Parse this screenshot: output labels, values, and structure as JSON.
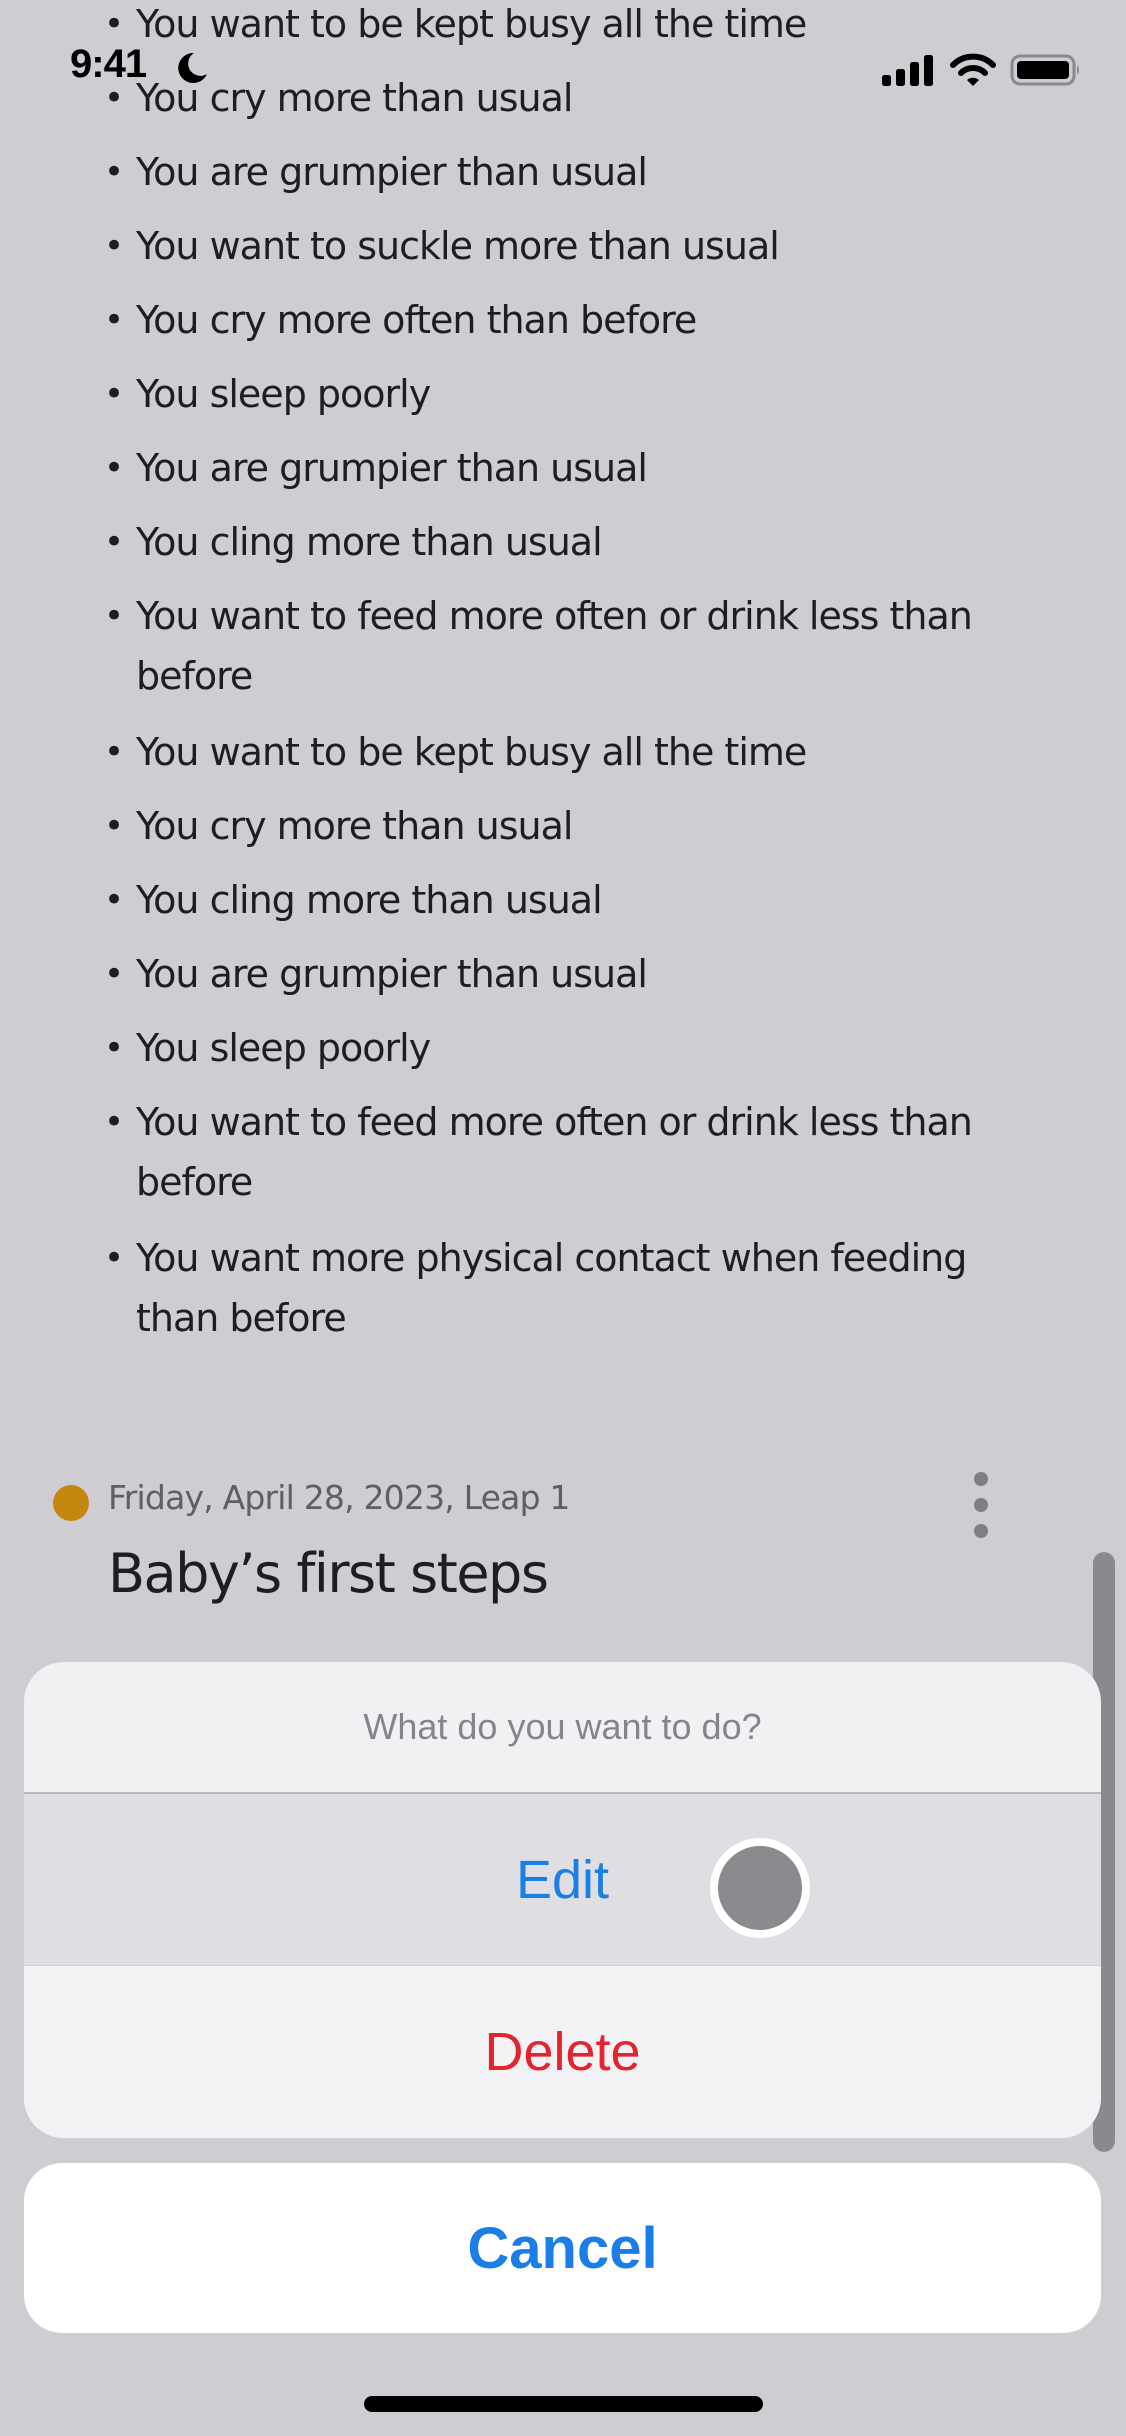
{
  "status_bar": {
    "time": "9:41",
    "focus_icon": "moon-icon",
    "signal_icon": "cellular-signal-icon",
    "wifi_icon": "wifi-icon",
    "battery_icon": "battery-icon"
  },
  "symptom_list": [
    "You want to be kept busy all the time",
    "You cry more than usual",
    "You are grumpier than usual",
    "You want to suckle more than usual",
    "You cry more often than before",
    "You sleep poorly",
    "You are grumpier than usual",
    "You cling more than usual",
    "You want to feed more often or drink less than before",
    "You want to be kept busy all the time",
    "You cry more than usual",
    "You cling more than usual",
    "You are grumpier than usual",
    "You sleep poorly",
    "You want to feed more often or drink less than before",
    "You want more physical contact when feeding than before"
  ],
  "bullet_char": "•",
  "entry": {
    "meta": "Friday, April 28, 2023, Leap 1",
    "title": "Baby’s first steps",
    "dot_color": "#c5870f",
    "more_icon": "more-vertical-icon"
  },
  "action_sheet": {
    "title": "What do you want to do?",
    "edit_label": "Edit",
    "delete_label": "Delete",
    "cancel_label": "Cancel",
    "accent_color": "#1a7ee6",
    "destructive_color": "#e3232e"
  }
}
